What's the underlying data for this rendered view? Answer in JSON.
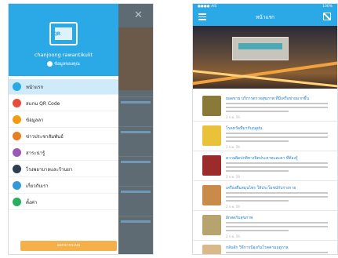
{
  "left_phone": {
    "logo_text": "QR",
    "user_name": "chanjoong rawantikulit",
    "user_role": "ข้อมูลของคุณ",
    "menu": [
      {
        "label": "หน้าแรก",
        "color": "#2aa9e6",
        "active": true
      },
      {
        "label": "สแกน QR Code",
        "color": "#e74c3c",
        "active": false
      },
      {
        "label": "ข้อมูลลา",
        "color": "#f39c12",
        "active": false
      },
      {
        "label": "ข่าวประชาสัมพันธ์",
        "color": "#e67e22",
        "active": false
      },
      {
        "label": "สาระน่ารู้",
        "color": "#9b59b6",
        "active": false
      },
      {
        "label": "โรงพยาบาลและร้านยา",
        "color": "#2c3e50",
        "active": false
      },
      {
        "label": "เกี่ยวกับเรา",
        "color": "#3498db",
        "active": false
      },
      {
        "label": "ตั้งค่า",
        "color": "#27ae60",
        "active": false
      }
    ],
    "footer_button": "ออกจากระบบ"
  },
  "right_phone": {
    "status_left": "●●●● AIS",
    "status_right": "100%",
    "title": "หน้าแรก",
    "news": [
      {
        "title": "ยอดขาย บริการตรวจสุขภาพ ที่มีเครือข่ายมากขึ้น",
        "date": "2 ก.ค. 59",
        "thumb": "#8a7a3a"
      },
      {
        "title": "โรคหวัดที่มากับฤดูฝน",
        "date": "2 ก.ค. 59",
        "thumb": "#e9c23a"
      },
      {
        "title": "ความผิดปกติทางจิตประสาทและตา ที่ต้องรู้",
        "date": "2 ก.ค. 59",
        "thumb": "#9c2c2c"
      },
      {
        "title": "เครื่องดื่มสมุนไพร ให้ประโยชน์กับร่างกาย",
        "date": "2 ก.ค. 59",
        "thumb": "#c98a4a"
      },
      {
        "title": "ผักสดกับสุขภาพ",
        "date": "2 ก.ค. 59",
        "thumb": "#b7a36e"
      },
      {
        "title": "กลับสัก วิธีการป้องกันโรคตามฤดูกาล",
        "date": "2 ก.ค. 59",
        "thumb": "#d9b98a"
      }
    ]
  }
}
